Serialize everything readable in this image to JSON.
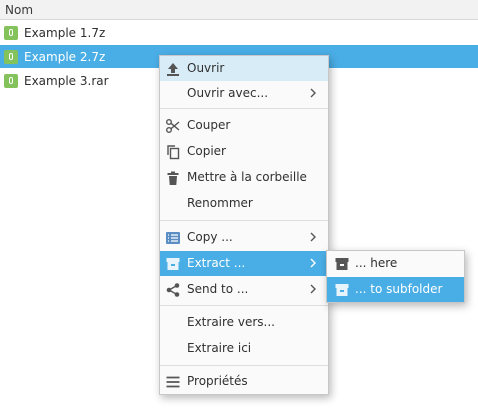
{
  "columns": {
    "name": "Nom"
  },
  "files": [
    {
      "name": "Example 1.7z"
    },
    {
      "name": "Example 2.7z"
    },
    {
      "name": "Example 3.rar"
    }
  ],
  "context_menu": {
    "items": [
      {
        "label": "Ouvrir",
        "icon": "upload-icon"
      },
      {
        "label": "Ouvrir avec...",
        "submenu": true
      },
      {
        "label": "Couper",
        "icon": "scissors-icon"
      },
      {
        "label": "Copier",
        "icon": "copy-icon"
      },
      {
        "label": "Mettre à la corbeille",
        "icon": "trash-icon"
      },
      {
        "label": "Renommer"
      },
      {
        "label": "Copy ...",
        "icon": "folder-list-icon",
        "submenu": true
      },
      {
        "label": "Extract ...",
        "icon": "archive-icon",
        "submenu": true
      },
      {
        "label": "Send to ...",
        "icon": "share-icon",
        "submenu": true
      },
      {
        "label": "Extraire vers..."
      },
      {
        "label": "Extraire ici"
      },
      {
        "label": "Propriétés",
        "icon": "properties-icon"
      }
    ]
  },
  "extract_submenu": {
    "items": [
      {
        "label": "... here",
        "icon": "archive-icon"
      },
      {
        "label": "... to subfolder",
        "icon": "archive-icon"
      }
    ]
  },
  "colors": {
    "selection": "#4aaee6",
    "archive_icon": "#84c25b",
    "menu_icon": "#555555"
  }
}
